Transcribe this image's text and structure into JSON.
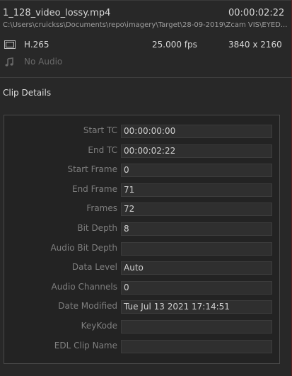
{
  "clip": {
    "name": "1_128_video_lossy.mp4",
    "duration": "00:00:02:22",
    "path": "C:\\Users\\cruickss\\Documents\\repo\\imagery\\Target\\28-09-2019\\Zcam VIS\\EYED..."
  },
  "video": {
    "icon": "film-icon",
    "codec": "H.265",
    "fps": "25.000 fps",
    "resolution": "3840 x 2160"
  },
  "audio": {
    "icon": "music-note-icon",
    "label": "No Audio"
  },
  "section_title": "Clip Details",
  "details": [
    {
      "label": "Start TC",
      "value": "00:00:00:00"
    },
    {
      "label": "End TC",
      "value": "00:00:02:22"
    },
    {
      "label": "Start Frame",
      "value": "0"
    },
    {
      "label": "End Frame",
      "value": "71"
    },
    {
      "label": "Frames",
      "value": "72"
    },
    {
      "label": "Bit Depth",
      "value": "8"
    },
    {
      "label": "Audio Bit Depth",
      "value": ""
    },
    {
      "label": "Data Level",
      "value": "Auto"
    },
    {
      "label": "Audio Channels",
      "value": "0"
    },
    {
      "label": "Date Modified",
      "value": "Tue Jul 13 2021 17:14:51"
    },
    {
      "label": "KeyKode",
      "value": ""
    },
    {
      "label": "EDL Clip Name",
      "value": ""
    }
  ]
}
